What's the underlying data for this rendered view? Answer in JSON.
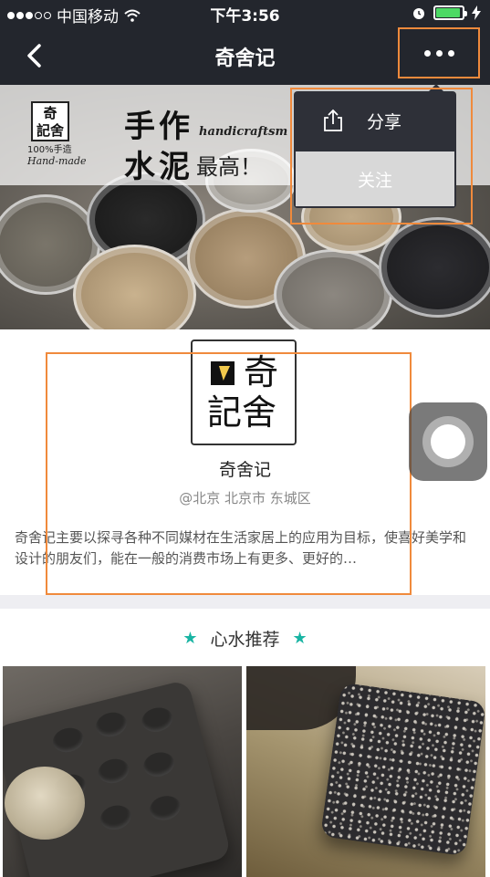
{
  "status_bar": {
    "carrier": "中国移动",
    "time": "下午3:56",
    "signal_filled": 2,
    "signal_total": 5,
    "battery_color": "#4cd964"
  },
  "nav": {
    "title": "奇舍记",
    "back_icon": "chevron-left-icon",
    "more_icon": "more-dots-icon"
  },
  "banner": {
    "logo_line1": "奇",
    "logo_line2": "記舍",
    "logo_sub": "100%手造",
    "logo_sub_en": "Hand-made",
    "headline_1": "手作",
    "headline_2": "水泥",
    "headline_en": "handicraftsm",
    "headline_3": "最高！"
  },
  "menu": {
    "share_label": "分享",
    "share_icon": "share-icon",
    "follow_label": "关注"
  },
  "profile": {
    "logo_text_top": "奇",
    "logo_text_bottom": "記舍",
    "name": "奇舍记",
    "location": "@北京 北京市 东城区",
    "description": "奇舍记主要以探寻各种不同媒材在生活家居上的应用为目标，使喜好美学和设计的朋友们，能在一般的消费市场上有更多、更好的…"
  },
  "recommend": {
    "title": "心水推荐",
    "star_icon": "star-icon",
    "accent": "#19b4a3"
  },
  "highlight_color": "#f08a3c"
}
